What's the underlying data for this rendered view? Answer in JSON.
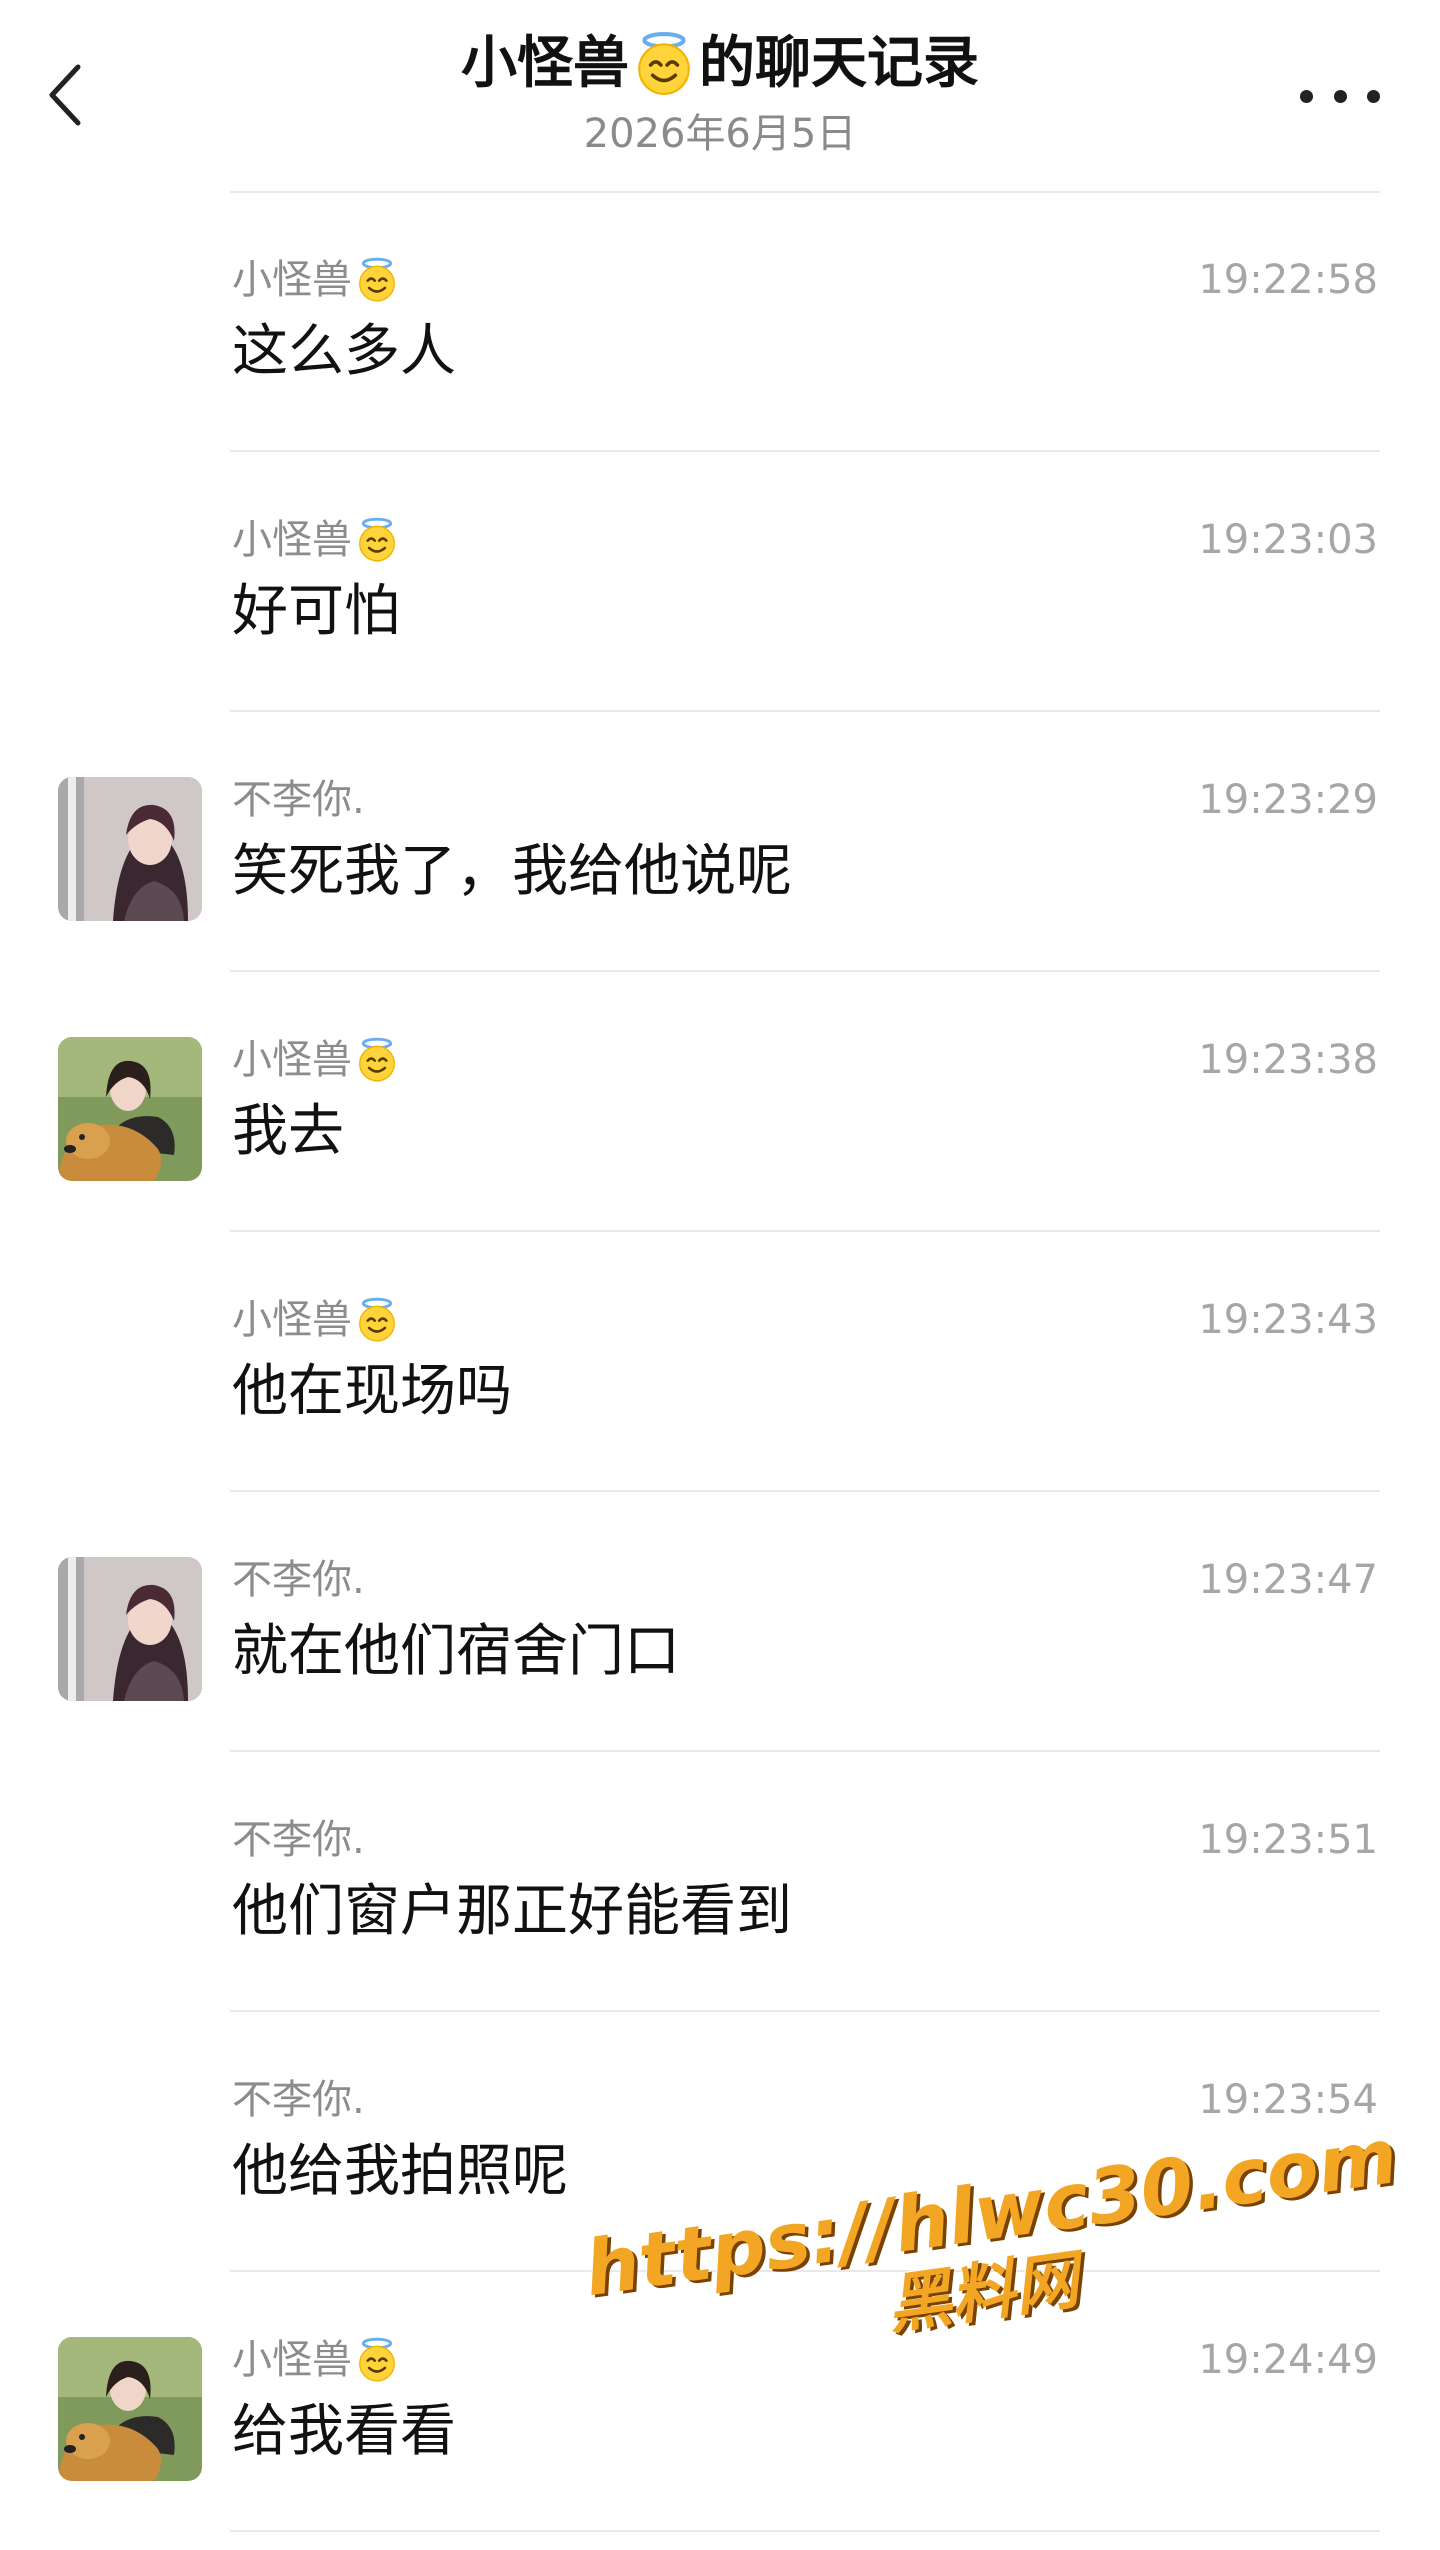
{
  "header": {
    "title_prefix": "小怪兽",
    "title_suffix": "的聊天记录",
    "date": "2026年6月5日"
  },
  "messages": [
    {
      "sender": "小怪兽",
      "time": "19:22:58",
      "text": "这么多人"
    },
    {
      "sender": "小怪兽",
      "time": "19:23:03",
      "text": "好可怕"
    },
    {
      "sender": "不李你.",
      "time": "19:23:29",
      "text": "笑死我了，我给他说呢"
    },
    {
      "sender": "小怪兽",
      "time": "19:23:38",
      "text": "我去"
    },
    {
      "sender": "小怪兽",
      "time": "19:23:43",
      "text": "他在现场吗"
    },
    {
      "sender": "不李你.",
      "time": "19:23:47",
      "text": "就在他们宿舍门口"
    },
    {
      "sender": "不李你.",
      "time": "19:23:51",
      "text": "他们窗户那正好能看到"
    },
    {
      "sender": "不李你.",
      "time": "19:23:54",
      "text": "他给我拍照呢"
    },
    {
      "sender": "小怪兽",
      "time": "19:24:49",
      "text": "给我看看"
    }
  ],
  "watermark": {
    "url": "https://hlwc30.com",
    "name": "黑料网"
  },
  "icons": {
    "back": "chevron-left-icon",
    "more": "more-dots-icon",
    "sender_emoji": "halo-smile-emoji"
  }
}
